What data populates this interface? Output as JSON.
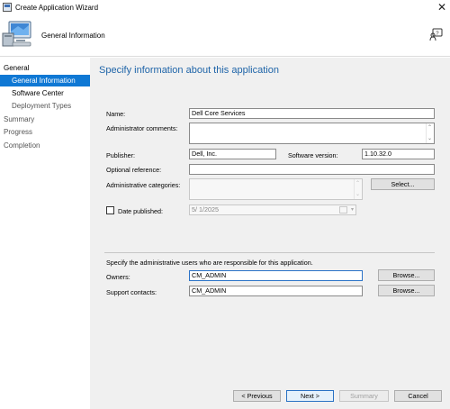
{
  "window": {
    "title": "Create Application Wizard",
    "close_glyph": "✕"
  },
  "header": {
    "step_title": "General Information"
  },
  "nav": {
    "general": "General",
    "general_information": "General Information",
    "software_center": "Software Center",
    "deployment_types": "Deployment Types",
    "summary": "Summary",
    "progress": "Progress",
    "completion": "Completion"
  },
  "page": {
    "heading": "Specify information about this application"
  },
  "form": {
    "name_label": "Name:",
    "name_value": "Dell Core Services",
    "admin_comments_label": "Administrator comments:",
    "admin_comments_value": "",
    "publisher_label": "Publisher:",
    "publisher_value": "Dell, Inc.",
    "software_version_label": "Software version:",
    "software_version_value": "1.10.32.0",
    "optional_reference_label": "Optional reference:",
    "optional_reference_value": "",
    "admin_categories_label": "Administrative categories:",
    "admin_categories_value": "",
    "select_button": "Select...",
    "date_published_label": "Date published:",
    "date_published_checked": false,
    "date_published_value": "5/ 1/2025"
  },
  "users": {
    "description": "Specify the administrative users who are responsible for this application.",
    "owners_label": "Owners:",
    "owners_value": "CM_ADMIN",
    "support_contacts_label": "Support contacts:",
    "support_contacts_value": "CM_ADMIN",
    "browse_button": "Browse..."
  },
  "footer": {
    "previous_button": "< Previous",
    "next_button": "Next >",
    "summary_button": "Summary",
    "cancel_button": "Cancel"
  }
}
